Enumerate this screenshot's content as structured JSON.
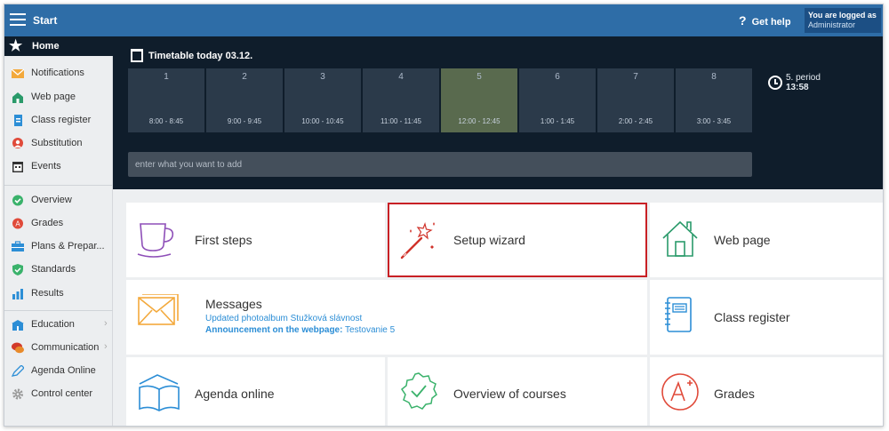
{
  "topbar": {
    "title": "Start",
    "help_label": "Get help",
    "help_glyph": "?",
    "logged_line1": "You are logged as",
    "logged_line2": "Administrator"
  },
  "sidebar": {
    "home_label": "Home",
    "items": [
      {
        "label": "Notifications",
        "icon": "envelope-icon"
      },
      {
        "label": "Web page",
        "icon": "house-icon"
      },
      {
        "label": "Class register",
        "icon": "book-icon"
      },
      {
        "label": "Substitution",
        "icon": "person-icon"
      },
      {
        "label": "Events",
        "icon": "calendar-icon"
      },
      {
        "label": "Overview",
        "icon": "check-circle-icon"
      },
      {
        "label": "Grades",
        "icon": "grade-badge-icon"
      },
      {
        "label": "Plans & Prepar...",
        "icon": "briefcase-icon"
      },
      {
        "label": "Standards",
        "icon": "shield-check-icon"
      },
      {
        "label": "Results",
        "icon": "bar-chart-icon"
      },
      {
        "label": "Education",
        "icon": "school-icon"
      },
      {
        "label": "Communication",
        "icon": "chat-icon"
      },
      {
        "label": "Agenda Online",
        "icon": "pen-icon"
      },
      {
        "label": "Control center",
        "icon": "gear-icon"
      }
    ]
  },
  "timetable": {
    "title": "Timetable today 03.12.",
    "slots": [
      {
        "num": "1",
        "time": "8:00 - 8:45"
      },
      {
        "num": "2",
        "time": "9:00 - 9:45"
      },
      {
        "num": "3",
        "time": "10:00 - 10:45"
      },
      {
        "num": "4",
        "time": "11:00 - 11:45"
      },
      {
        "num": "5",
        "time": "12:00 - 12:45"
      },
      {
        "num": "6",
        "time": "1:00 - 1:45"
      },
      {
        "num": "7",
        "time": "2:00 - 2:45"
      },
      {
        "num": "8",
        "time": "3:00 - 3:45"
      }
    ],
    "active_slot": "5",
    "period_label": "5. period",
    "period_time": "13:58",
    "add_placeholder": "enter what you want to add"
  },
  "tiles": {
    "first_steps": "First steps",
    "setup_wizard": "Setup wizard",
    "web_page": "Web page",
    "messages": "Messages",
    "messages_line1": "Updated photoalbum Stužková slávnost",
    "messages_line2_label": "Announcement on the webpage:",
    "messages_line2_value": " Testovanie 5",
    "class_register": "Class register",
    "agenda_online": "Agenda online",
    "overview_courses": "Overview of courses",
    "grades": "Grades"
  },
  "colors": {
    "topbar": "#2e6da7",
    "dark_panel": "#0f1d2b",
    "active_slot": "#596a4e",
    "highlight": "#c82025",
    "link": "#2c8ed6"
  }
}
